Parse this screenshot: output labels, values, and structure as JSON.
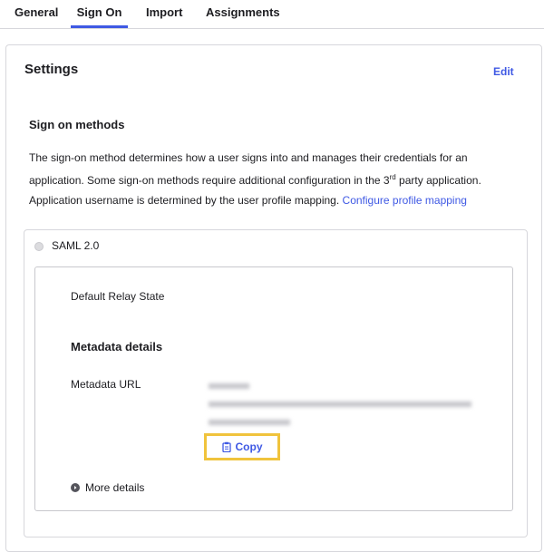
{
  "tabs": [
    {
      "label": "General"
    },
    {
      "label": "Sign On",
      "active": true
    },
    {
      "label": "Import"
    },
    {
      "label": "Assignments"
    }
  ],
  "settings": {
    "title": "Settings",
    "edit_label": "Edit"
  },
  "sign_on": {
    "section_title": "Sign on methods",
    "description_part1": "The sign-on method determines how a user signs into and manages their credentials for an application. Some sign-on methods require additional configuration in the 3",
    "description_sup": "rd",
    "description_part2": " party application.",
    "username_text": "Application username is determined by the user profile mapping. ",
    "username_link": "Configure profile mapping"
  },
  "method": {
    "radio_label": "SAML 2.0",
    "relay_state_label": "Default Relay State",
    "metadata_title": "Metadata details",
    "metadata_url_label": "Metadata URL",
    "copy_label": "Copy",
    "more_details_label": "More details"
  },
  "colors": {
    "accent": "#3f59e4",
    "highlight": "#f0c33c"
  }
}
